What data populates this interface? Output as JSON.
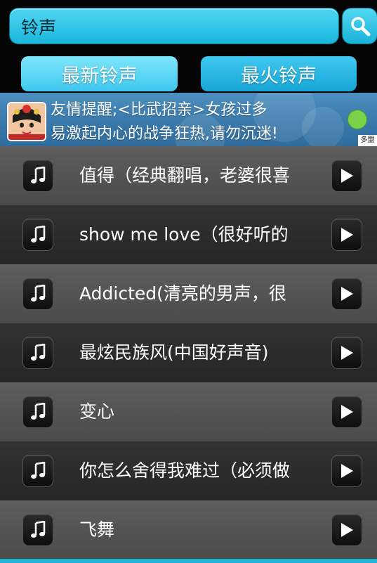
{
  "search": {
    "value": "铃声",
    "icon": "search-icon"
  },
  "tabs": {
    "new_label": "最新铃声",
    "hot_label": "最火铃声"
  },
  "ad": {
    "line1": "友情提醒;<比武招亲>女孩过多",
    "line2": "易激起内心的战争狂热,请勿沉迷!",
    "brand": "多盟"
  },
  "ringtones": [
    {
      "title": "值得（经典翻唱，老婆很喜"
    },
    {
      "title": "show me love（很好听的"
    },
    {
      "title": "Addicted(清亮的男声，很"
    },
    {
      "title": "最炫民族风(中国好声音)"
    },
    {
      "title": "变心"
    },
    {
      "title": "你怎么舍得我难过（必须做"
    },
    {
      "title": "飞舞"
    }
  ],
  "colors": {
    "accent": "#1eb2d7",
    "tab_active": "#7ee6fb",
    "row_light": "#555555",
    "row_dark": "#2b2b2b"
  }
}
